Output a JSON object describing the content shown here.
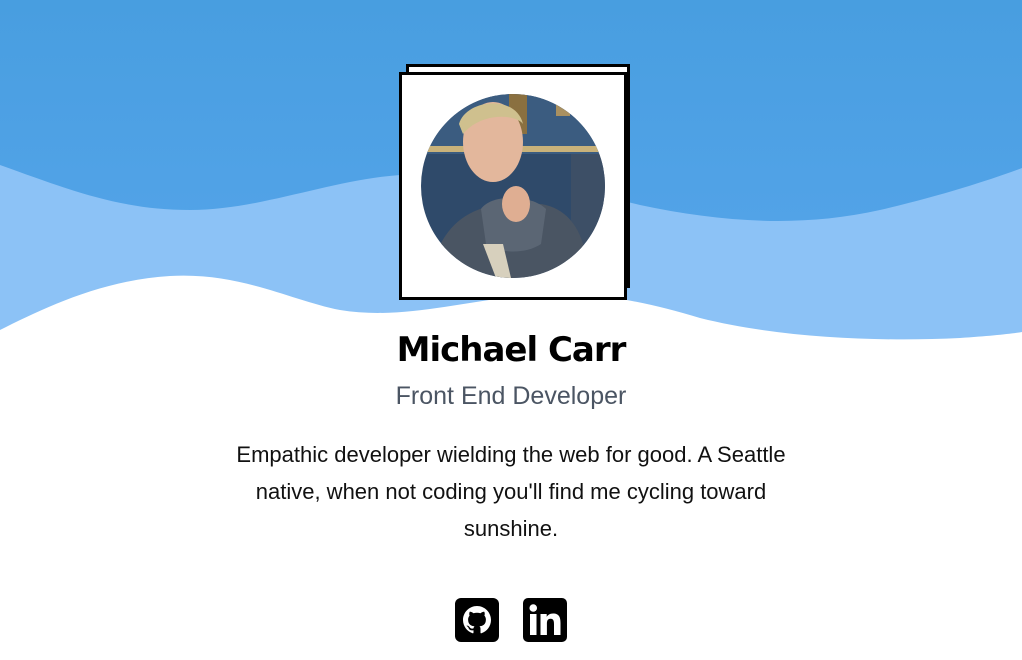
{
  "profile": {
    "name": "Michael Carr",
    "role": "Front End Developer",
    "bio": "Empathic developer wielding the web for good. A Seattle native, when not coding you'll find me cycling toward sunshine."
  },
  "social": {
    "github_label": "GitHub",
    "linkedin_label": "LinkedIn",
    "github_icon": "github-icon",
    "linkedin_icon": "linkedin-icon"
  },
  "colors": {
    "sky_top": "#4a9fe1",
    "wave_light": "#8cc2f6",
    "text_primary": "#000000",
    "text_secondary": "#4b5563"
  }
}
